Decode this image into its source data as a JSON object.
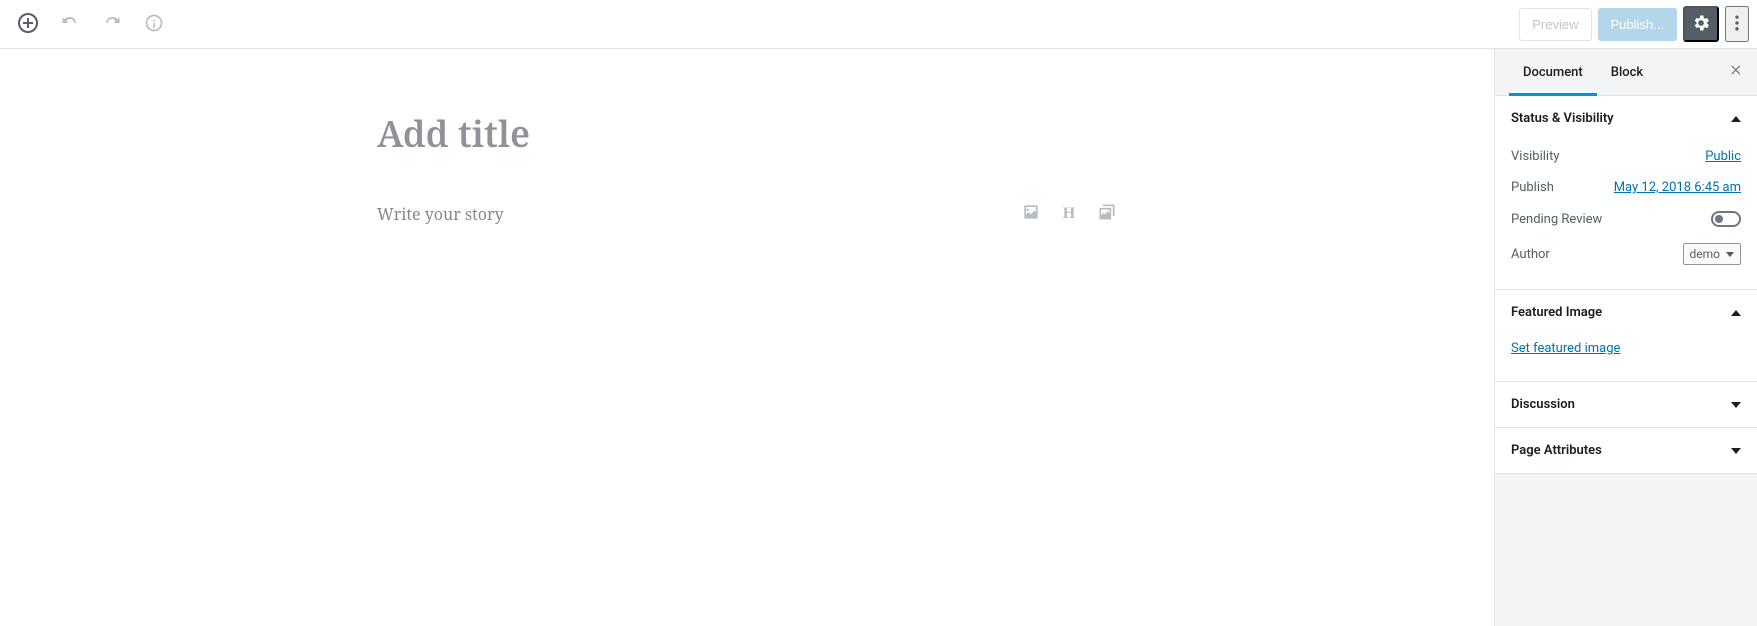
{
  "toolbar": {
    "preview_label": "Preview",
    "publish_label": "Publish..."
  },
  "editor": {
    "title_placeholder": "Add title",
    "paragraph_placeholder": "Write your story"
  },
  "sidebar": {
    "tabs": {
      "document": "Document",
      "block": "Block"
    },
    "panels": {
      "status": {
        "title": "Status & Visibility",
        "visibility_label": "Visibility",
        "visibility_value": "Public",
        "publish_label": "Publish",
        "publish_value": "May 12, 2018 6:45 am",
        "pending_label": "Pending Review",
        "author_label": "Author",
        "author_value": "demo"
      },
      "featured": {
        "title": "Featured Image",
        "set_link": "Set featured image"
      },
      "discussion": {
        "title": "Discussion"
      },
      "attributes": {
        "title": "Page Attributes"
      }
    }
  }
}
